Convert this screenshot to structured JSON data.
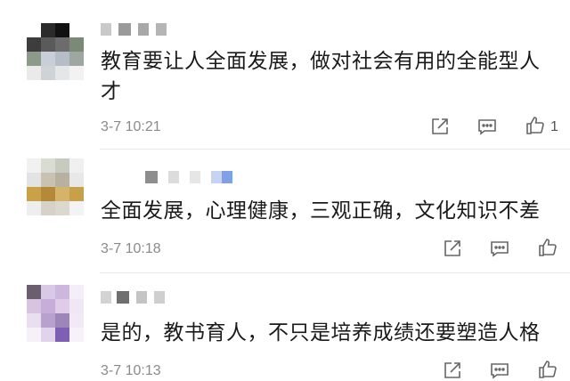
{
  "comments": [
    {
      "text_line1": "教育要让人全面发展，做对社会有用的全能型人",
      "text_line2": "才",
      "time": "3-7 10:21",
      "likes": "1"
    },
    {
      "text_line1": "全面发展，心理健康，三观正确，文化知识不差",
      "time": "3-7 10:18"
    },
    {
      "text_line1": "是的，教书育人，不只是培养成绩还要塑造人格",
      "time": "3-7 10:13"
    }
  ],
  "icons": {
    "share": "share-icon",
    "reply": "reply-icon",
    "like": "thumbs-up-icon"
  }
}
